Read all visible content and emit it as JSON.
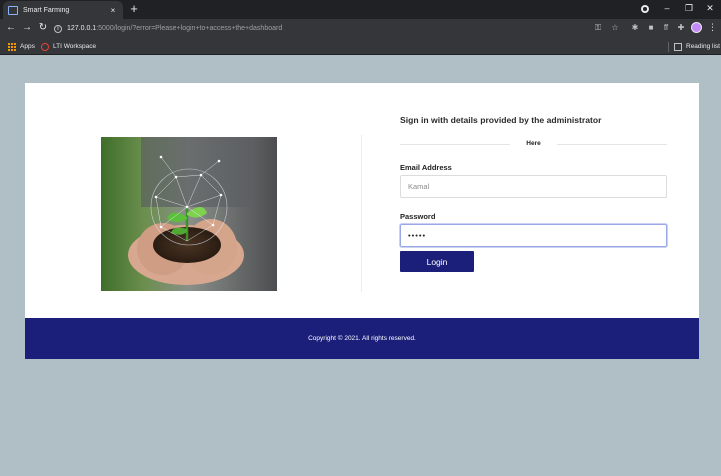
{
  "browser": {
    "tab_title": "Smart Farming",
    "tab_close": "×",
    "new_tab": "+",
    "url_host": "127.0.0.1",
    "url_rest": ":5000/login/?error=Please+login+to+access+the+dashboard",
    "bookmarks": [
      "Apps",
      "LTI Workspace"
    ],
    "reading_list": "Reading list",
    "icons": [
      "back-arrow-icon",
      "forward-arrow-icon",
      "reload-icon",
      "info-icon",
      "key-icon",
      "star-icon",
      "extension-icon",
      "puzzle-icon",
      "profile-icon",
      "menu-icon"
    ]
  },
  "login": {
    "heading": "Sign in with details provided by the administrator",
    "divider_text": "Here",
    "email_label": "Email Address",
    "email_value": "Kamal",
    "password_label": "Password",
    "password_value": "•••••",
    "submit_label": "Login"
  },
  "footer": {
    "copyright": "Copyright © 2021. All rights reserved."
  },
  "colors": {
    "page_background": "#b0bfc6",
    "accent": "#1b1f7a",
    "card": "#ffffff"
  }
}
